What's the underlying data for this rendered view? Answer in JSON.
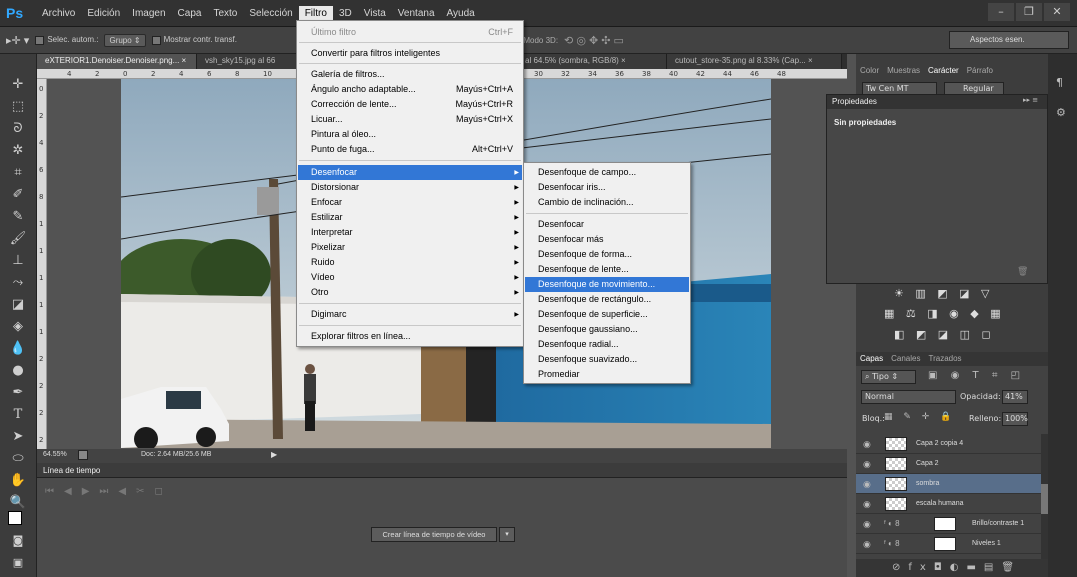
{
  "app": {
    "logo": "Ps"
  },
  "menubar": {
    "items": [
      "Archivo",
      "Edición",
      "Imagen",
      "Capa",
      "Texto",
      "Selección",
      "Filtro",
      "3D",
      "Vista",
      "Ventana",
      "Ayuda"
    ],
    "active": "Filtro"
  },
  "window_controls": {
    "minimize": "–",
    "restore": "❐",
    "close": "✕"
  },
  "options_bar": {
    "auto_select": "Selec. autom.:",
    "group": "Grupo",
    "show_transform": "Mostrar contr. transf.",
    "mode3d": "Modo 3D:",
    "workspace": "Aspectos esen."
  },
  "tabs": [
    {
      "label": "eXTERIOR1.Denoiser.Denoiser.png... ×"
    },
    {
      "label": "vsh_sky15.jpg al 66"
    },
    {
      "label": "al 64.5% (sombra, RGB/8) ×"
    },
    {
      "label": "cutout_store-35.png al 8.33% (Cap... ×"
    }
  ],
  "ruler_h": [
    "4",
    "2",
    "0",
    "2",
    "4",
    "6",
    "8",
    "10",
    "28",
    "30",
    "32",
    "34",
    "36",
    "38",
    "40",
    "42",
    "44",
    "46",
    "48"
  ],
  "ruler_v": [
    "0",
    "2",
    "4",
    "6",
    "8",
    "1",
    "1",
    "1",
    "1",
    "1",
    "2",
    "2",
    "2",
    "2"
  ],
  "status": {
    "zoom": "64.55%",
    "doc": "Doc: 2.64 MB/25.6 MB"
  },
  "timeline": {
    "title": "Línea de tiempo",
    "create_button": "Crear línea de tiempo de vídeo"
  },
  "filter_menu": {
    "last_filter": "Último filtro",
    "last_filter_sc": "Ctrl+F",
    "convert": "Convertir para filtros inteligentes",
    "gallery": "Galería de filtros...",
    "adaptive": "Ángulo ancho adaptable...",
    "adaptive_sc": "Mayús+Ctrl+A",
    "lens": "Corrección de lente...",
    "lens_sc": "Mayús+Ctrl+R",
    "liquify": "Licuar...",
    "liquify_sc": "Mayús+Ctrl+X",
    "oil": "Pintura al óleo...",
    "vanish": "Punto de fuga...",
    "vanish_sc": "Alt+Ctrl+V",
    "blur": "Desenfocar",
    "distort": "Distorsionar",
    "sharpen": "Enfocar",
    "stylize": "Estilizar",
    "interpret": "Interpretar",
    "pixelate": "Pixelizar",
    "noise": "Ruido",
    "video": "Vídeo",
    "other": "Otro",
    "digimarc": "Digimarc",
    "browse": "Explorar filtros en línea..."
  },
  "blur_submenu": {
    "field": "Desenfoque de campo...",
    "iris": "Desenfocar iris...",
    "tilt": "Cambio de inclinación...",
    "blur": "Desenfocar",
    "blur_more": "Desenfocar más",
    "shape": "Desenfoque de forma...",
    "lens": "Desenfoque de lente...",
    "motion": "Desenfoque de movimiento...",
    "box": "Desenfoque de rectángulo...",
    "surface": "Desenfoque de superficie...",
    "gaussian": "Desenfoque gaussiano...",
    "radial": "Desenfoque radial...",
    "smart": "Desenfoque suavizado...",
    "average": "Promediar"
  },
  "char_panel": {
    "tabs": [
      "Color",
      "Muestras",
      "Carácter",
      "Párrafo"
    ],
    "font": "Tw Cen MT",
    "style": "Regular"
  },
  "props_panel": {
    "title": "Propiedades",
    "content": "Sin propiedades"
  },
  "layers_panel": {
    "tabs": [
      "Capas",
      "Canales",
      "Trazados"
    ],
    "kind": "Tipo",
    "blend": "Normal",
    "opacity_label": "Opacidad:",
    "opacity": "41%",
    "lock_label": "Bloq.:",
    "fill_label": "Relleno:",
    "fill": "100%",
    "layers": [
      {
        "name": "Capa 2 copia 4"
      },
      {
        "name": "Capa 2"
      },
      {
        "name": "sombra"
      },
      {
        "name": "escala humana"
      },
      {
        "name": "Brillo/contraste 1"
      },
      {
        "name": "Niveles 1"
      }
    ]
  },
  "colors": {
    "highlight": "#3277d6",
    "wall_blue": "#1f6aa0",
    "sky": "#b9ccd8"
  }
}
